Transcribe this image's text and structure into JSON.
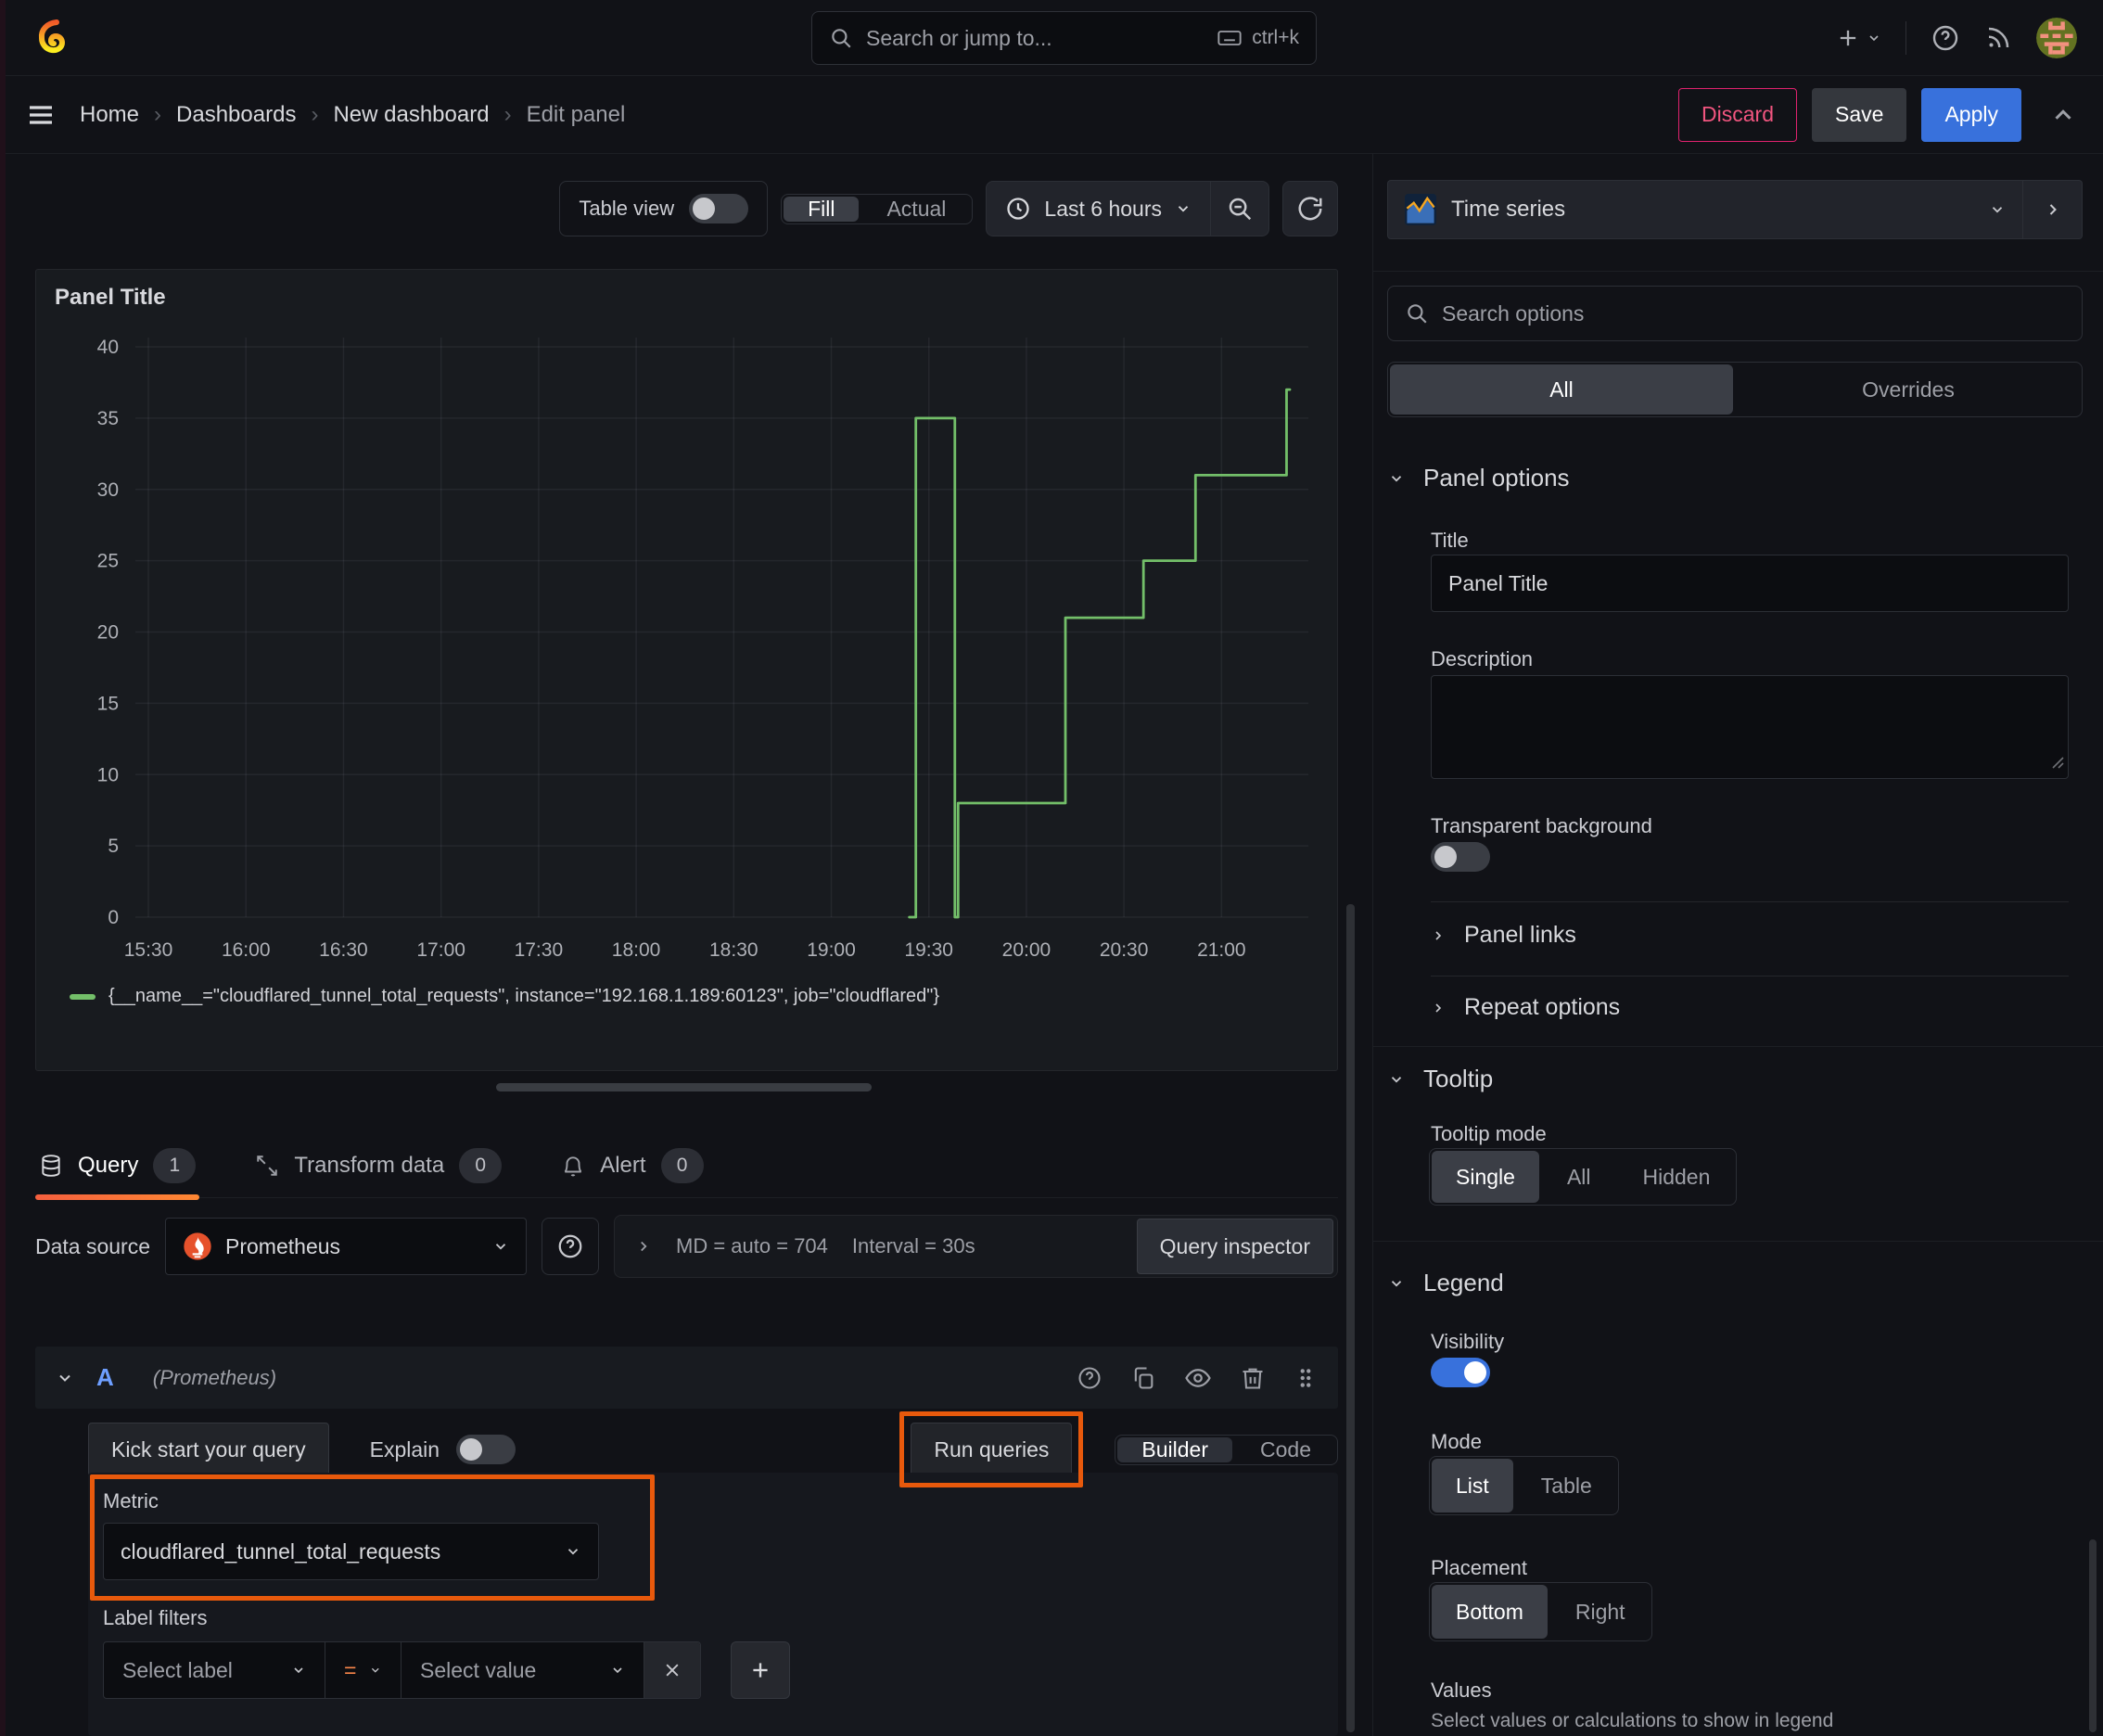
{
  "colors": {
    "accent": "#e8590c",
    "green": "#73BF69",
    "blue": "#3871dc",
    "pink": "#eb3b6c",
    "orange-grad-start": "#f55f3e",
    "orange-grad-end": "#ff8833"
  },
  "topnav": {
    "search_placeholder": "Search or jump to...",
    "search_shortcut": "ctrl+k"
  },
  "breadcrumb": {
    "items": [
      "Home",
      "Dashboards",
      "New dashboard",
      "Edit panel"
    ]
  },
  "actions": {
    "discard": "Discard",
    "save": "Save",
    "apply": "Apply"
  },
  "toolbar": {
    "table_view": "Table view",
    "fill": "Fill",
    "actual": "Actual",
    "time_range": "Last 6 hours"
  },
  "panel": {
    "title": "Panel Title"
  },
  "chart_data": {
    "type": "line",
    "step": true,
    "title": "Panel Title",
    "grid": true,
    "legend_position": "bottom",
    "ylim": [
      0,
      40
    ],
    "y_ticks": [
      0,
      5,
      10,
      15,
      20,
      25,
      30,
      35,
      40
    ],
    "x_ticks": [
      "15:30",
      "16:00",
      "16:30",
      "17:00",
      "17:30",
      "18:00",
      "18:30",
      "19:00",
      "19:30",
      "20:00",
      "20:30",
      "21:00"
    ],
    "x_domain": [
      "15:26",
      "21:21"
    ],
    "series": [
      {
        "name": "{__name__=\"cloudflared_tunnel_total_requests\", instance=\"192.168.1.189:60123\", job=\"cloudflared\"}",
        "color": "#73BF69",
        "points": [
          [
            "19:24",
            0
          ],
          [
            "19:26",
            35
          ],
          [
            "19:38",
            0
          ],
          [
            "19:39",
            8
          ],
          [
            "20:12",
            21
          ],
          [
            "20:36",
            25
          ],
          [
            "20:52",
            31
          ],
          [
            "21:20",
            37
          ]
        ],
        "end": "21:21"
      }
    ]
  },
  "tabs": {
    "items": [
      {
        "label": "Query",
        "count": "1"
      },
      {
        "label": "Transform data",
        "count": "0"
      },
      {
        "label": "Alert",
        "count": "0"
      }
    ]
  },
  "ds": {
    "label": "Data source",
    "value": "Prometheus",
    "md": "MD = auto = 704",
    "interval": "Interval = 30s",
    "inspector": "Query inspector"
  },
  "query": {
    "ref": "A",
    "ds_hint": "(Prometheus)",
    "kickstart": "Kick start your query",
    "explain": "Explain",
    "run": "Run queries",
    "modes": [
      "Builder",
      "Code"
    ],
    "metric_label": "Metric",
    "metric_value": "cloudflared_tunnel_total_requests",
    "label_filters": "Label filters",
    "select_label": "Select label",
    "op": "=",
    "select_value": "Select value"
  },
  "sidebar": {
    "viz": "Time series",
    "search_placeholder": "Search options",
    "scope": [
      "All",
      "Overrides"
    ],
    "panel_options": {
      "heading": "Panel options",
      "title_label": "Title",
      "title_value": "Panel Title",
      "description_label": "Description",
      "transparent_label": "Transparent background"
    },
    "links_heading": "Panel links",
    "repeat_heading": "Repeat options",
    "tooltip": {
      "heading": "Tooltip",
      "mode_label": "Tooltip mode",
      "modes": [
        "Single",
        "All",
        "Hidden"
      ]
    },
    "legend": {
      "heading": "Legend",
      "visibility_label": "Visibility",
      "mode_label": "Mode",
      "modes": [
        "List",
        "Table"
      ],
      "placement_label": "Placement",
      "placements": [
        "Bottom",
        "Right"
      ],
      "values_label": "Values",
      "values_hint": "Select values or calculations to show in legend"
    }
  }
}
